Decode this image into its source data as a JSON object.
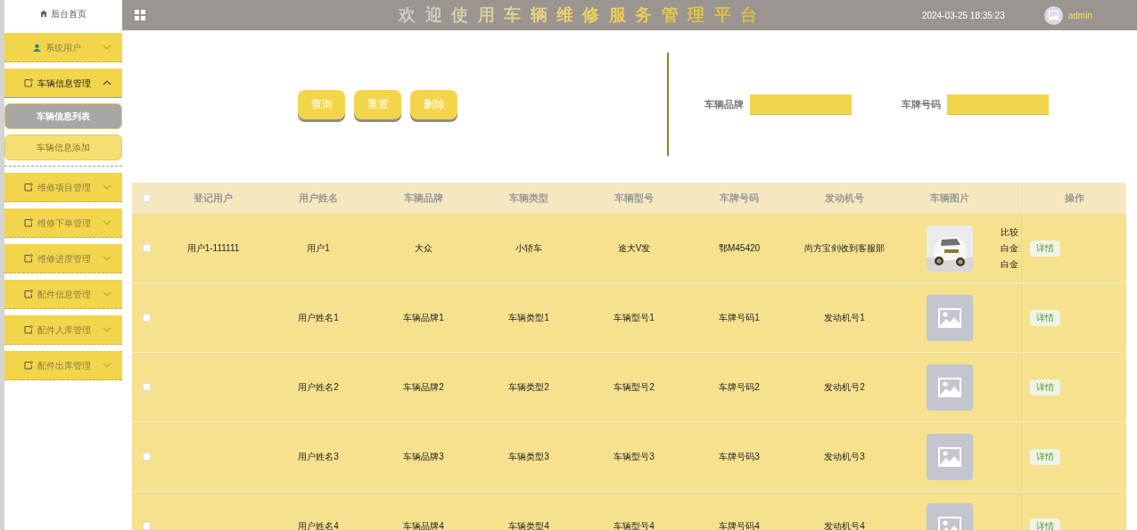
{
  "sidebar": {
    "home": "后台首页",
    "items": [
      {
        "label": "系统用户",
        "kind": "user",
        "expanded": false
      },
      {
        "label": "车辆信息管理",
        "kind": "note",
        "expanded": true,
        "children": [
          {
            "label": "车辆信息列表",
            "selected": true
          },
          {
            "label": "车辆信息添加",
            "selected": false
          }
        ]
      },
      {
        "label": "维修项目管理",
        "kind": "note",
        "expanded": false
      },
      {
        "label": "维修下单管理",
        "kind": "note",
        "expanded": false
      },
      {
        "label": "维修进度管理",
        "kind": "note",
        "expanded": false
      },
      {
        "label": "配件信息管理",
        "kind": "note",
        "expanded": false
      },
      {
        "label": "配件入库管理",
        "kind": "note",
        "expanded": false
      },
      {
        "label": "配件出库管理",
        "kind": "note",
        "expanded": false
      }
    ]
  },
  "header": {
    "title": "欢迎使用车辆维修服务管理平台",
    "datetime": "2024-03-25 18:35:23",
    "user": "admin"
  },
  "search": {
    "buttons": [
      "查询",
      "重置",
      "删除"
    ],
    "fields": [
      {
        "label": "车辆品牌"
      },
      {
        "label": "车牌号码"
      }
    ]
  },
  "table": {
    "select_all_checked": false,
    "columns": [
      "登记用户",
      "用户姓名",
      "车辆品牌",
      "车辆类型",
      "车辆型号",
      "车牌号码",
      "发动机号"
    ],
    "image_column": "车辆图片",
    "action_column": "操作",
    "rows": [
      {
        "checked": false,
        "user": "用户1-111111",
        "name": "用户1",
        "brand": "大众",
        "type": "小轿车",
        "model": "途大V发",
        "plate": "鄂M45420",
        "engine": "尚方宝剑收到客服部",
        "column_9": [
          "比较",
          "白金",
          "白金"
        ],
        "action": "详情"
      },
      {
        "checked": false,
        "name": "用户姓名1",
        "brand": "车辆品牌1",
        "type": "车辆类型1",
        "model": "车辆型号1",
        "plate": "车牌号码1",
        "engine": "发动机号1",
        "kind": "placeholder",
        "action": "详情"
      },
      {
        "checked": false,
        "name": "用户姓名2",
        "brand": "车辆品牌2",
        "type": "车辆类型2",
        "model": "车辆型号2",
        "plate": "车牌号码2",
        "engine": "发动机号2",
        "kind": "placeholder",
        "action": "详情"
      },
      {
        "checked": false,
        "name": "用户姓名3",
        "brand": "车辆品牌3",
        "type": "车辆类型3",
        "model": "车辆型号3",
        "plate": "车牌号码3",
        "engine": "发动机号3",
        "kind": "placeholder",
        "action": "详情"
      },
      {
        "checked": false,
        "name": "用户姓名4",
        "brand": "车辆品牌4",
        "type": "车辆类型4",
        "model": "车辆型号4",
        "plate": "车牌号码4",
        "engine": "发动机号4",
        "kind": "placeholder",
        "action": "详情"
      }
    ]
  }
}
